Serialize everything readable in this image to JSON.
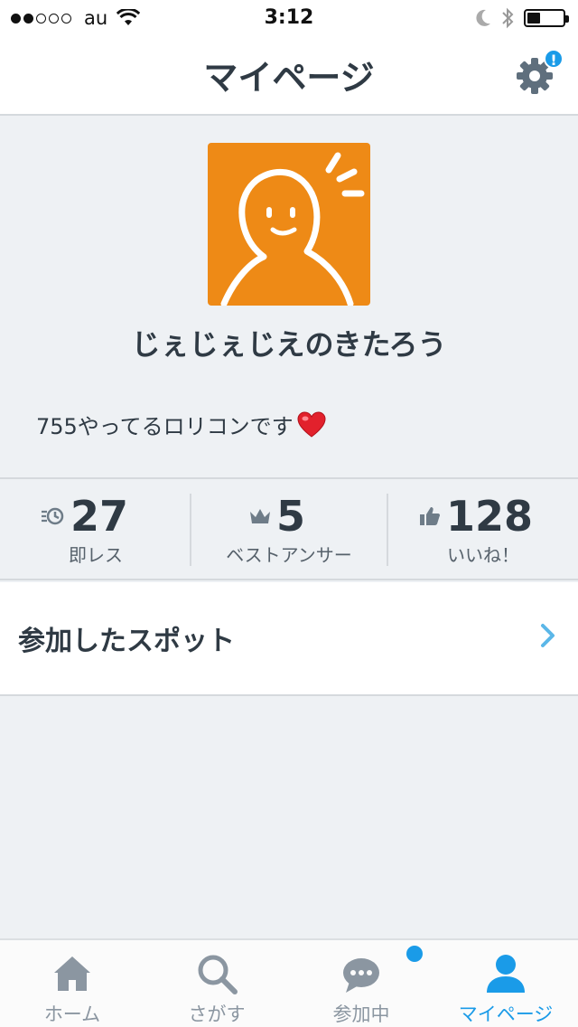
{
  "status_bar": {
    "carrier": "au",
    "time": "3:12",
    "icons": [
      "signal-dots",
      "wifi-icon",
      "moon-icon",
      "bluetooth-icon",
      "battery-icon"
    ]
  },
  "nav": {
    "title": "マイページ",
    "settings_badge": "!"
  },
  "profile": {
    "avatar_bg": "#ee8a16",
    "username": "じぇじぇじえのきたろう",
    "bio": "755やってるロリコンです",
    "bio_emoji": "heart-icon"
  },
  "stats": [
    {
      "icon": "instant-reply-icon",
      "value": "27",
      "label": "即レス"
    },
    {
      "icon": "crown-icon",
      "value": "5",
      "label": "ベストアンサー"
    },
    {
      "icon": "thumbs-up-icon",
      "value": "128",
      "label": "いいね！"
    }
  ],
  "joined_spots": {
    "label": "参加したスポット"
  },
  "tab_bar": {
    "tabs": [
      {
        "label": "ホーム",
        "icon": "home-icon",
        "active": false
      },
      {
        "label": "さがす",
        "icon": "search-icon",
        "active": false
      },
      {
        "label": "参加中",
        "icon": "chat-bubble-icon",
        "active": false
      },
      {
        "label": "マイページ",
        "icon": "person-icon",
        "active": true
      }
    ]
  },
  "colors": {
    "accent": "#1a9be8",
    "text": "#2f3a44",
    "background": "#eef1f4",
    "inactive": "#8b96a1"
  }
}
